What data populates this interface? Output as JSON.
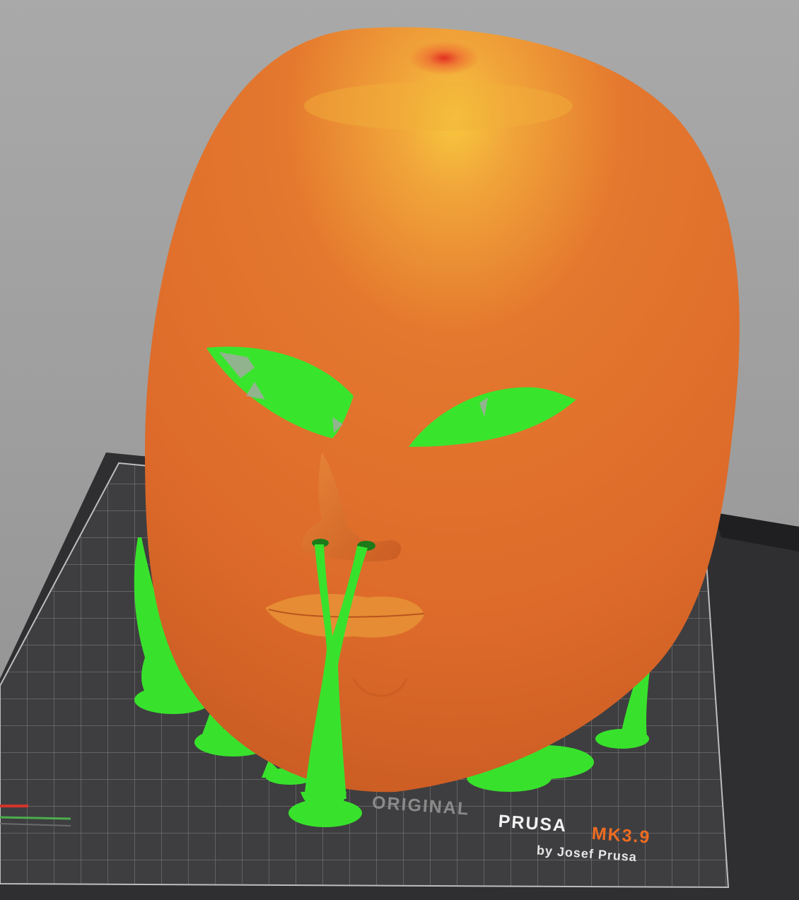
{
  "viewport": {
    "bed_brand_prefix": "ORIGINAL",
    "bed_brand_name": "PRUSA",
    "bed_brand_model": "MK3.9",
    "bed_brand_byline": "by Josef Prusa"
  },
  "colors": {
    "background": "#9f9f9f",
    "bed_sheet": "#3c3c3e",
    "bed_grid": "#8a8a8a",
    "model_perimeter": "#e06a2a",
    "model_highlight": "#f2b23c",
    "support_material": "#37e62b",
    "brand_accent": "#ee6c22"
  },
  "icons": [
    "legend-indicator-icon"
  ]
}
